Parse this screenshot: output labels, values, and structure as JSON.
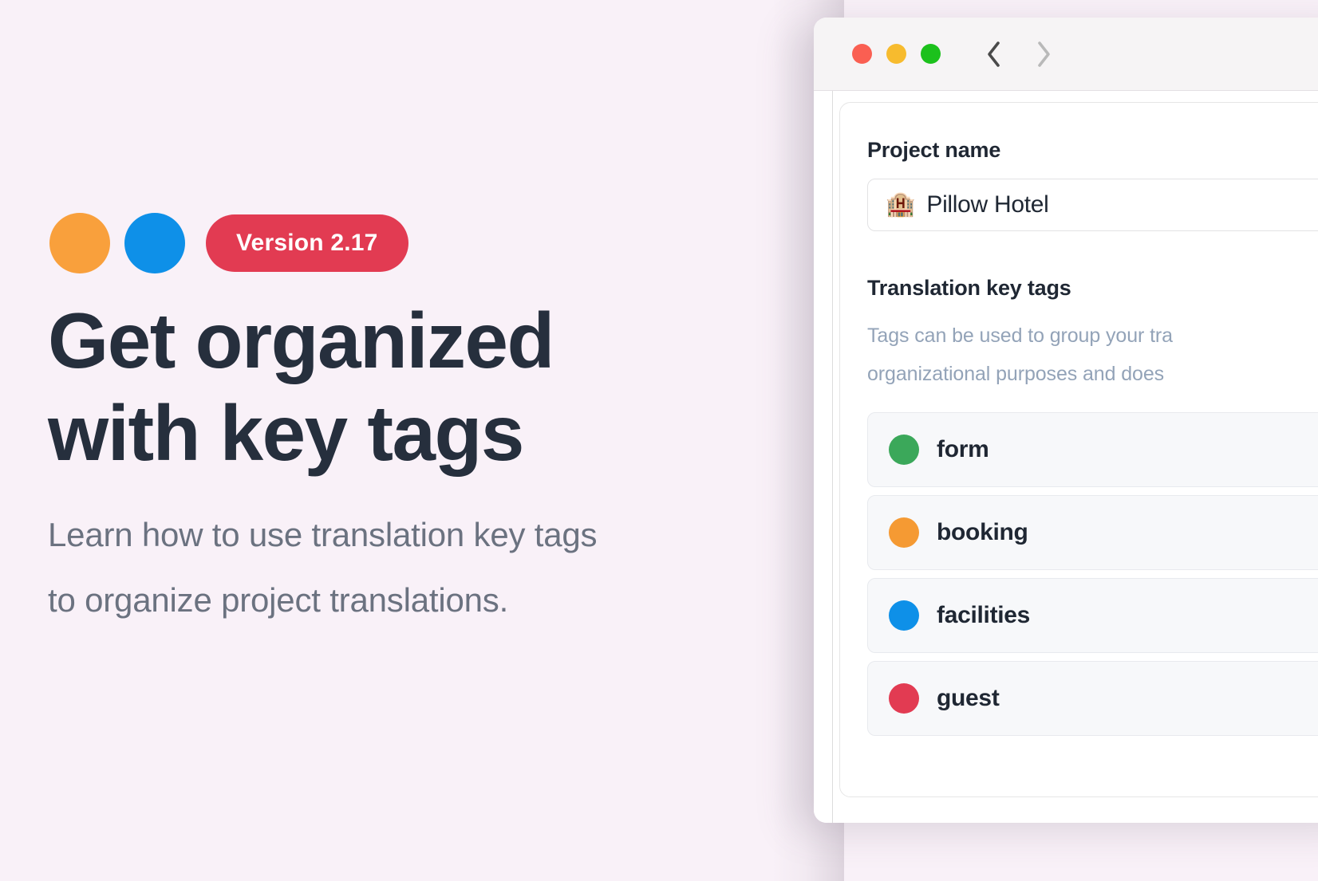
{
  "hero": {
    "accent_dots": [
      {
        "name": "orange-dot",
        "color": "#F9A03C"
      },
      {
        "name": "blue-dot",
        "color": "#0E90E8"
      }
    ],
    "version_badge": {
      "label": "Version 2.17",
      "color": "#E23B52"
    },
    "title_line1": "Get organized",
    "title_line2": "with key tags",
    "subtitle_line1": "Learn how to use translation key tags",
    "subtitle_line2": "to organize project translations.",
    "background_color": "#F9F1F8",
    "title_color": "#262F3D",
    "subtitle_color": "#6B7280"
  },
  "window": {
    "traffic_lights": [
      {
        "name": "close-button",
        "color": "#FA5F52"
      },
      {
        "name": "minimize-button",
        "color": "#F7BB2E"
      },
      {
        "name": "maximize-button",
        "color": "#1CC11C"
      }
    ],
    "nav": {
      "back_icon": "chevron-left-icon",
      "forward_icon": "chevron-right-icon",
      "back_enabled": "true",
      "forward_enabled": "false"
    }
  },
  "form": {
    "project_name_label": "Project name",
    "project_name_emoji": "🏨",
    "project_name_value": "Pillow Hotel",
    "tags_label": "Translation key tags",
    "tags_help": "Tags can be used to group your tra\norganizational purposes and does",
    "tags": [
      {
        "label": "form",
        "color": "#3BA85A"
      },
      {
        "label": "booking",
        "color": "#F59A33"
      },
      {
        "label": "facilities",
        "color": "#0E90E8"
      },
      {
        "label": "guest",
        "color": "#E23B52"
      }
    ]
  }
}
